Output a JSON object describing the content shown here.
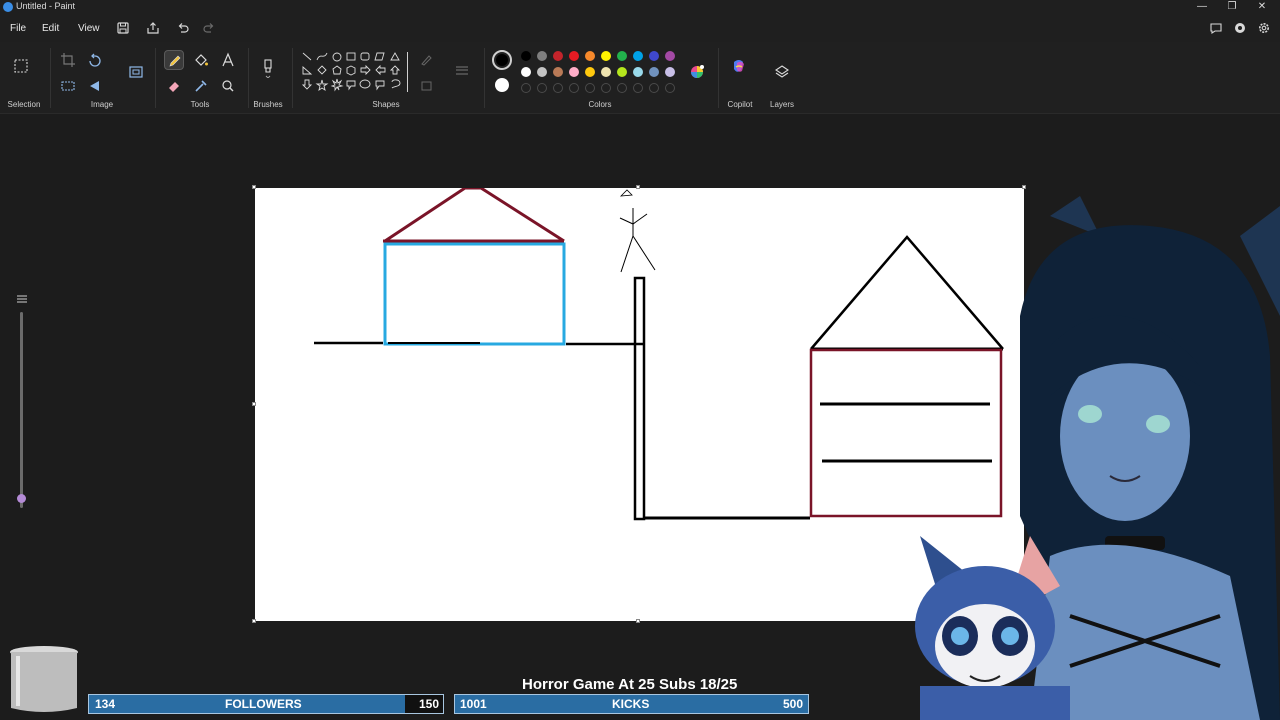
{
  "window": {
    "title": "Untitled - Paint",
    "minimize": "—",
    "maximize": "❐",
    "close": "✕"
  },
  "menu": {
    "file": "File",
    "edit": "Edit",
    "view": "View"
  },
  "ribbon": {
    "groups": {
      "selection": "Selection",
      "image": "Image",
      "tools": "Tools",
      "brushes": "Brushes",
      "shapes": "Shapes",
      "colors": "Colors",
      "copilot": "Copilot",
      "layers": "Layers"
    },
    "active_tool": "pencil",
    "primary_color": "#000000",
    "secondary_color": "#ffffff",
    "palette": [
      "#000000",
      "#7f7f7f",
      "#c3242b",
      "#e81b23",
      "#f7892b",
      "#fff200",
      "#22b14c",
      "#00a2e8",
      "#3f48cc",
      "#a349a4",
      "#ffffff",
      "#c3c3c3",
      "#b97a57",
      "#ffaec9",
      "#ffc90e",
      "#efe4b0",
      "#b5e61d",
      "#99d9ea",
      "#7092be",
      "#c8bfe7"
    ]
  },
  "zoom": {
    "level_fraction": 0.05
  },
  "stream_overlay": {
    "goal_text": "Horror Game At 25 Subs 18/25",
    "followers": {
      "current": "134",
      "label": "FOLLOWERS",
      "target": "150",
      "progress": 0.893
    },
    "kicks": {
      "current": "1001",
      "label": "KICKS",
      "target": "500",
      "progress": 1.0
    }
  },
  "colors": {
    "house_outline_dark_red": "#7a1428",
    "house_outline_blue": "#27a9e1",
    "ink": "#000000"
  }
}
